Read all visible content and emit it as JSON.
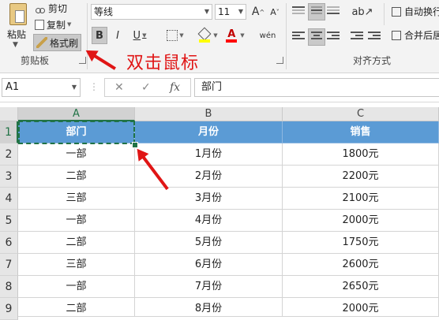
{
  "clipboard": {
    "paste_label": "粘贴",
    "cut_label": "剪切",
    "copy_label": "复制",
    "format_painter_label": "格式刷",
    "group_label": "剪贴板"
  },
  "font": {
    "name": "等线",
    "size": "11",
    "grow_icon": "A",
    "shrink_icon": "A",
    "bold": "B",
    "italic": "I",
    "underline": "U",
    "font_color_glyph": "A",
    "phonetic_glyph": "wén"
  },
  "alignment": {
    "group_label": "对齐方式",
    "wrap_text_label": "自动换行",
    "merge_label": "合并后居"
  },
  "annotation": {
    "text": "双击鼠标",
    "color": "#e01515"
  },
  "formula_bar": {
    "name_box": "A1",
    "fx_label": "fx",
    "content": "部门"
  },
  "sheet": {
    "columns": [
      "A",
      "B",
      "C"
    ],
    "rows": [
      "1",
      "2",
      "3",
      "4",
      "5",
      "6",
      "7",
      "8",
      "9"
    ],
    "header_fill": "#5b9bd5",
    "selection_color": "#217346",
    "data": [
      [
        "部门",
        "月份",
        "销售"
      ],
      [
        "一部",
        "1月份",
        "1800元"
      ],
      [
        "二部",
        "2月份",
        "2200元"
      ],
      [
        "三部",
        "3月份",
        "2100元"
      ],
      [
        "一部",
        "4月份",
        "2000元"
      ],
      [
        "二部",
        "5月份",
        "1750元"
      ],
      [
        "三部",
        "6月份",
        "2600元"
      ],
      [
        "一部",
        "7月份",
        "2650元"
      ],
      [
        "二部",
        "8月份",
        "2000元"
      ]
    ]
  }
}
